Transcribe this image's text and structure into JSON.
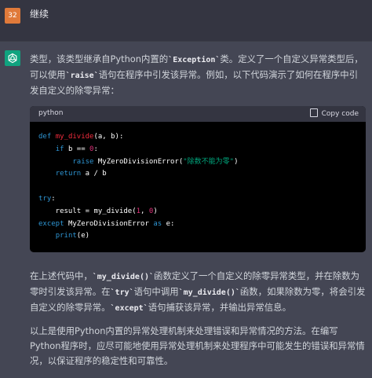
{
  "user": {
    "avatar_text": "32",
    "message": "继续"
  },
  "assistant": {
    "avatar_icon": "openai-logo-icon",
    "paragraph1": [
      {
        "t": "类型，该类型继承自Python内置的",
        "code": false
      },
      {
        "t": "`Exception`",
        "code": true
      },
      {
        "t": "类。定义了一个自定义异常类型后，可以使用",
        "code": false
      },
      {
        "t": "`raise`",
        "code": true
      },
      {
        "t": "语句在程序中引发该异常。例如，以下代码演示了如何在程序中引发自定义的除零异常：",
        "code": false
      }
    ],
    "code": {
      "language": "python",
      "copy_label": "Copy code",
      "lines": [
        [
          {
            "t": "def ",
            "c": "kw"
          },
          {
            "t": "my_divide",
            "c": "fn"
          },
          {
            "t": "(a, b):",
            "c": "pl"
          }
        ],
        [
          {
            "t": "    ",
            "c": "pl"
          },
          {
            "t": "if ",
            "c": "kw"
          },
          {
            "t": "b == ",
            "c": "pl"
          },
          {
            "t": "0",
            "c": "num"
          },
          {
            "t": ":",
            "c": "pl"
          }
        ],
        [
          {
            "t": "        ",
            "c": "pl"
          },
          {
            "t": "raise ",
            "c": "kw"
          },
          {
            "t": "MyZeroDivisionError(",
            "c": "pl"
          },
          {
            "t": "\"除数不能为零\"",
            "c": "str"
          },
          {
            "t": ")",
            "c": "pl"
          }
        ],
        [
          {
            "t": "    ",
            "c": "pl"
          },
          {
            "t": "return ",
            "c": "kw"
          },
          {
            "t": "a / b",
            "c": "pl"
          }
        ],
        [],
        [
          {
            "t": "try",
            "c": "kw"
          },
          {
            "t": ":",
            "c": "pl"
          }
        ],
        [
          {
            "t": "    result = my_divide(",
            "c": "pl"
          },
          {
            "t": "1",
            "c": "num"
          },
          {
            "t": ", ",
            "c": "pl"
          },
          {
            "t": "0",
            "c": "num"
          },
          {
            "t": ")",
            "c": "pl"
          }
        ],
        [
          {
            "t": "except ",
            "c": "kw"
          },
          {
            "t": "MyZeroDivisionError ",
            "c": "pl"
          },
          {
            "t": "as ",
            "c": "kw"
          },
          {
            "t": "e:",
            "c": "pl"
          }
        ],
        [
          {
            "t": "    ",
            "c": "pl"
          },
          {
            "t": "print",
            "c": "kw"
          },
          {
            "t": "(e)",
            "c": "pl"
          }
        ]
      ]
    },
    "paragraph2": [
      {
        "t": "在上述代码中，",
        "code": false
      },
      {
        "t": "`my_divide()`",
        "code": true
      },
      {
        "t": "函数定义了一个自定义的除零异常类型，并在除数为零时引发该异常。在",
        "code": false
      },
      {
        "t": "`try`",
        "code": true
      },
      {
        "t": "语句中调用",
        "code": false
      },
      {
        "t": "`my_divide()`",
        "code": true
      },
      {
        "t": "函数，如果除数为零，将会引发自定义的除零异常。",
        "code": false
      },
      {
        "t": "`except`",
        "code": true
      },
      {
        "t": "语句捕获该异常，并输出异常信息。",
        "code": false
      }
    ],
    "paragraph3": "以上是使用Python内置的异常处理机制来处理错误和异常情况的方法。在编写Python程序时，应尽可能地使用异常处理机制来处理程序中可能发生的错误和异常情况，以保证程序的稳定性和可靠性。"
  },
  "colors": {
    "background": "#444654",
    "user_row": "#343541",
    "code_bg": "#000000",
    "keyword": "#2e95d3",
    "function": "#f22c3d",
    "number": "#df3079",
    "string": "#00a67d",
    "gpt_avatar": "#10a37f",
    "user_avatar": "#e07a3a"
  }
}
